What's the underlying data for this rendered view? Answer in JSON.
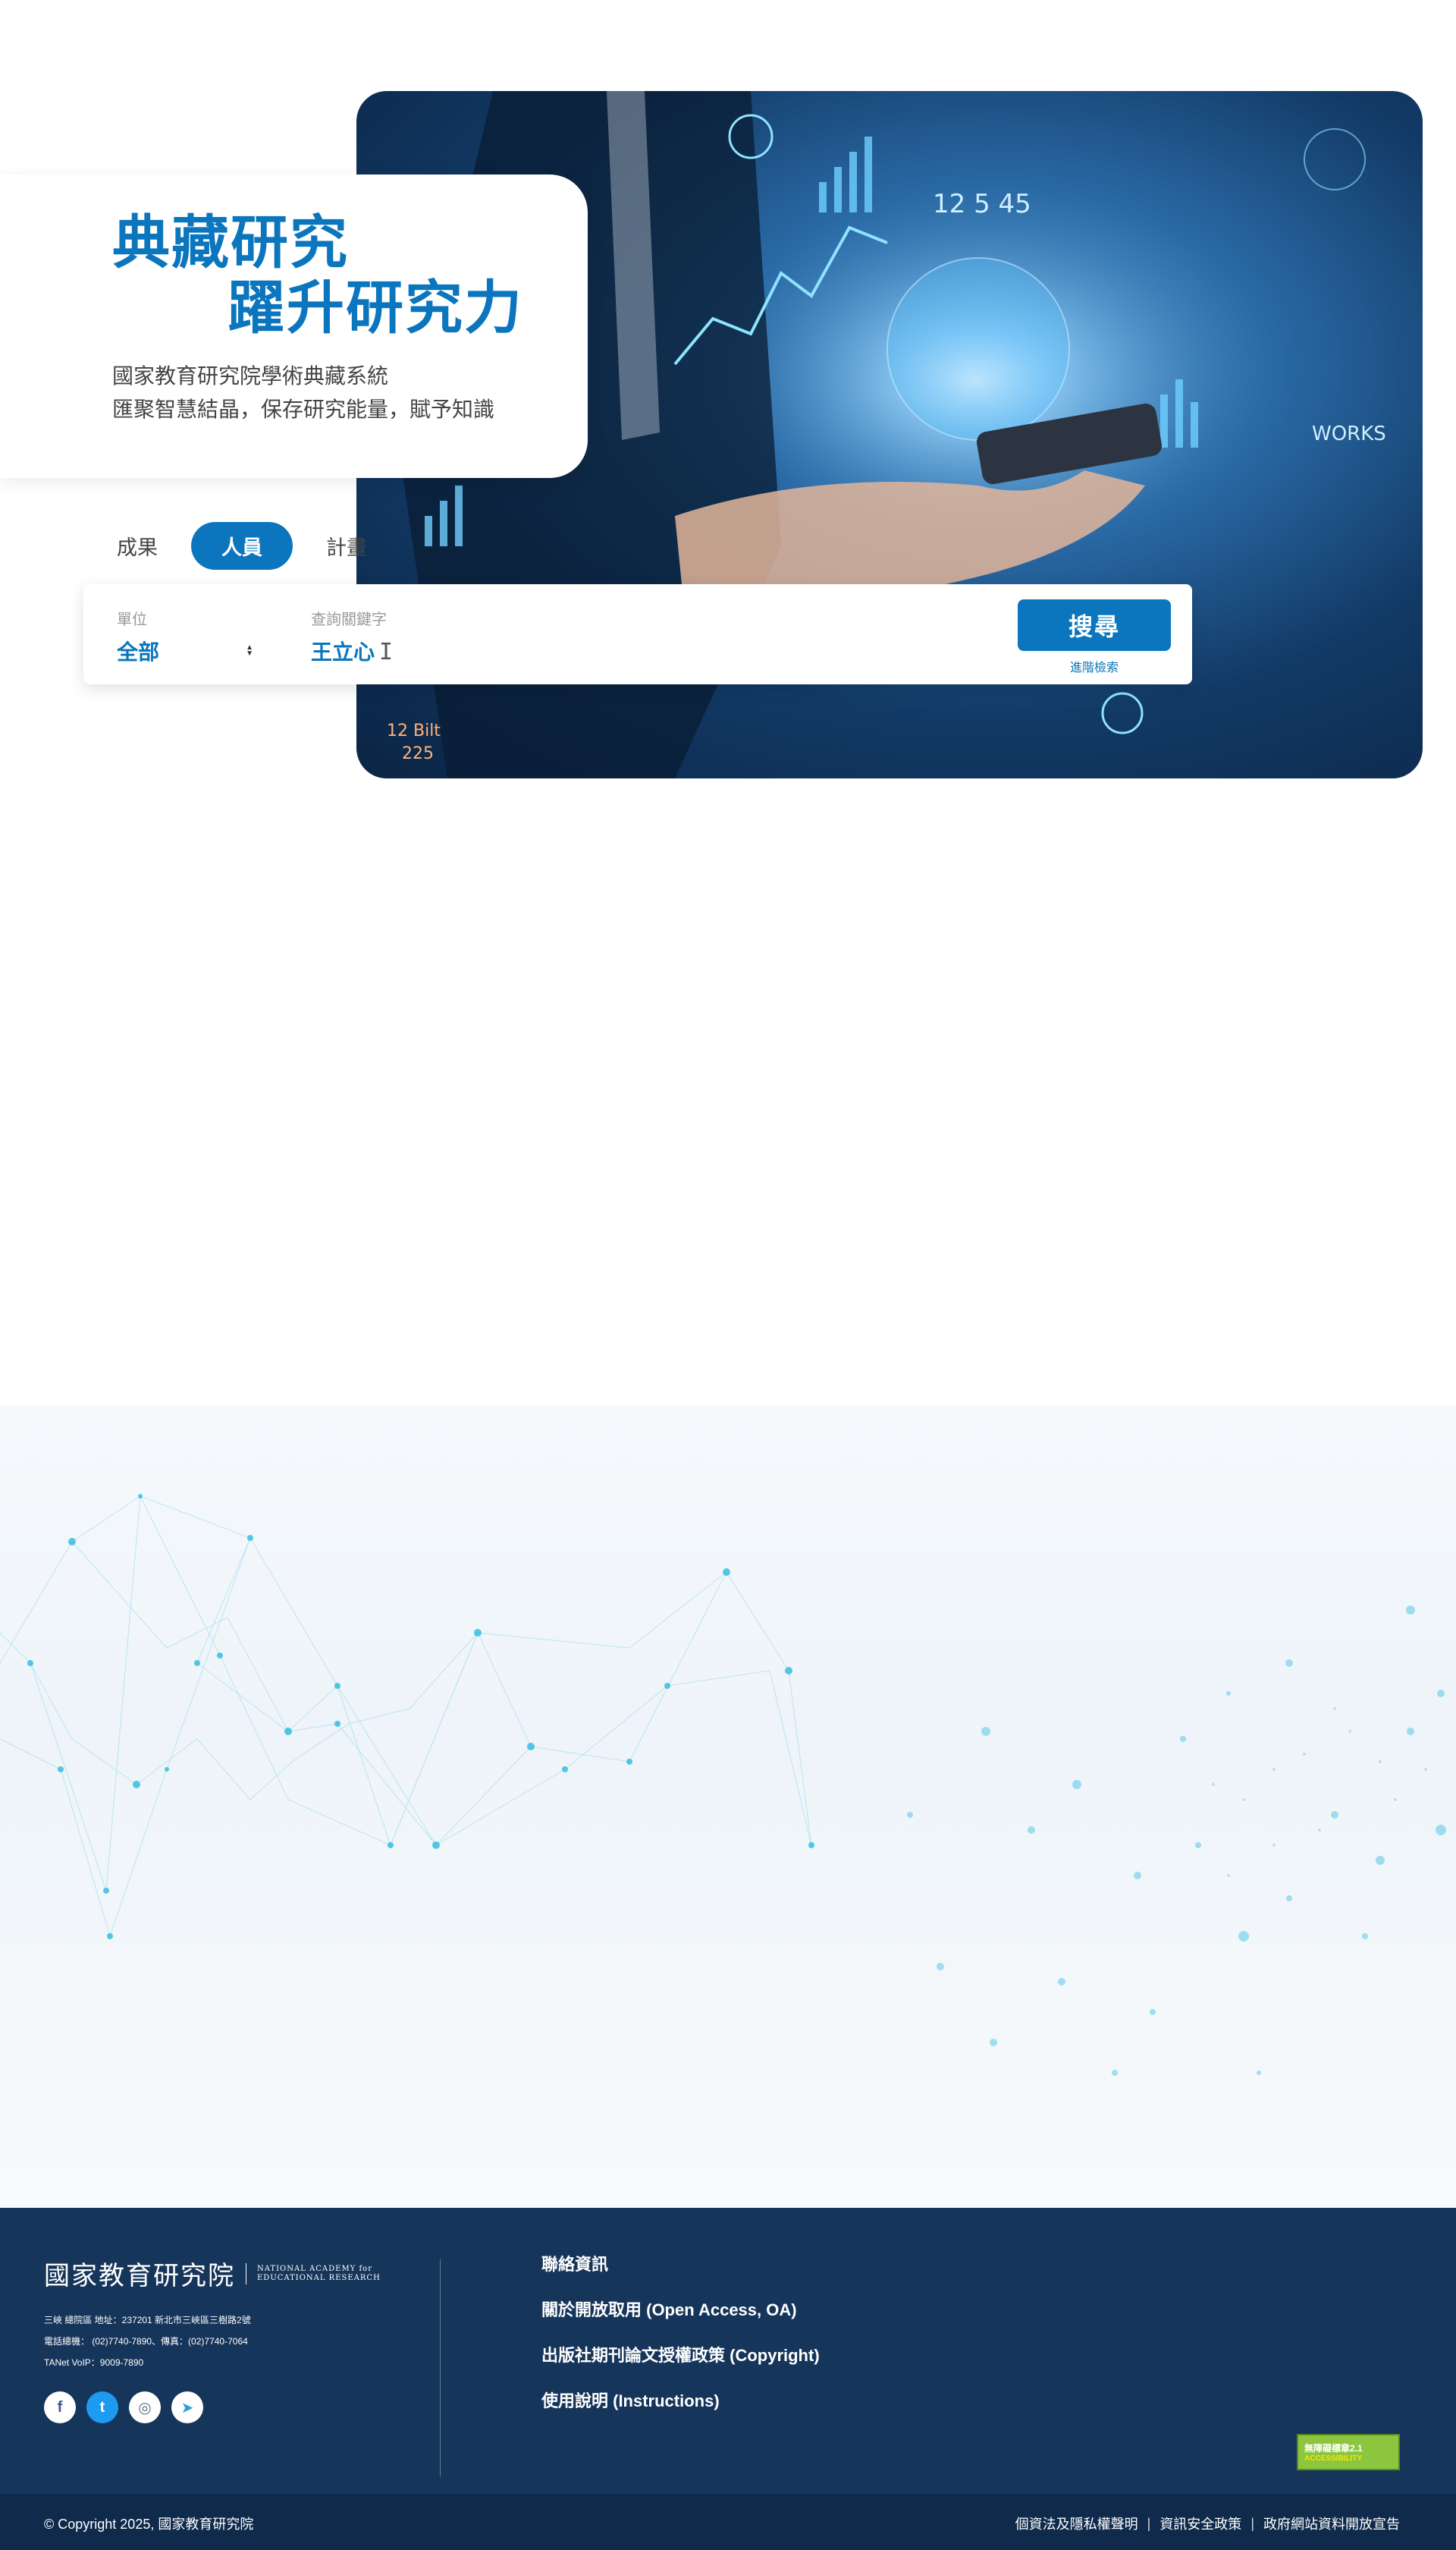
{
  "hero": {
    "title_line1": "典藏研究",
    "title_line2": "躍升研究力",
    "subtitle_line1": "國家教育研究院學術典藏系統",
    "subtitle_line2": "匯聚智慧結晶，保存研究能量，賦予知識"
  },
  "search": {
    "tabs": [
      {
        "label": "成果",
        "active": false
      },
      {
        "label": "人員",
        "active": true
      },
      {
        "label": "計畫",
        "active": false
      }
    ],
    "unit_label": "單位",
    "unit_value": "全部",
    "keyword_label": "查詢關鍵字",
    "keyword_value": "王立心",
    "search_button": "搜尋",
    "advanced_link": "進階檢索"
  },
  "footer": {
    "logo_text": "國家教育研究院",
    "logo_en_line1": "NATIONAL ACADEMY for",
    "logo_en_line2": "EDUCATIONAL RESEARCH",
    "address": "三峽 總院區 地址：237201 新北市三峽區三樹路2號",
    "phone": "電話總機： (02)7740-7890、傳真：(02)7740-7064",
    "voip": "TANet VoIP：9009-7890",
    "links": [
      "聯絡資訊",
      "關於開放取用 (Open Access, OA)",
      "出版社期刊論文授權政策 (Copyright)",
      "使用說明 (Instructions)"
    ],
    "accessibility_line1": "無障礙標章2.1",
    "accessibility_line2": "ACCESSIBILITY",
    "copyright": "© Copyright 2025, 國家教育研究院",
    "bottom_links": [
      "個資法及隱私權聲明",
      "資訊安全政策",
      "政府網站資料開放宣告"
    ],
    "social": [
      {
        "name": "facebook-icon",
        "glyph": "f"
      },
      {
        "name": "twitter-icon",
        "glyph": "t"
      },
      {
        "name": "instagram-icon",
        "glyph": "◎"
      },
      {
        "name": "telegram-icon",
        "glyph": "➤"
      }
    ]
  },
  "colors": {
    "brand_blue": "#0b76bd",
    "footer_navy": "#16355a",
    "footer_bottom_navy": "#0f2a4b"
  }
}
